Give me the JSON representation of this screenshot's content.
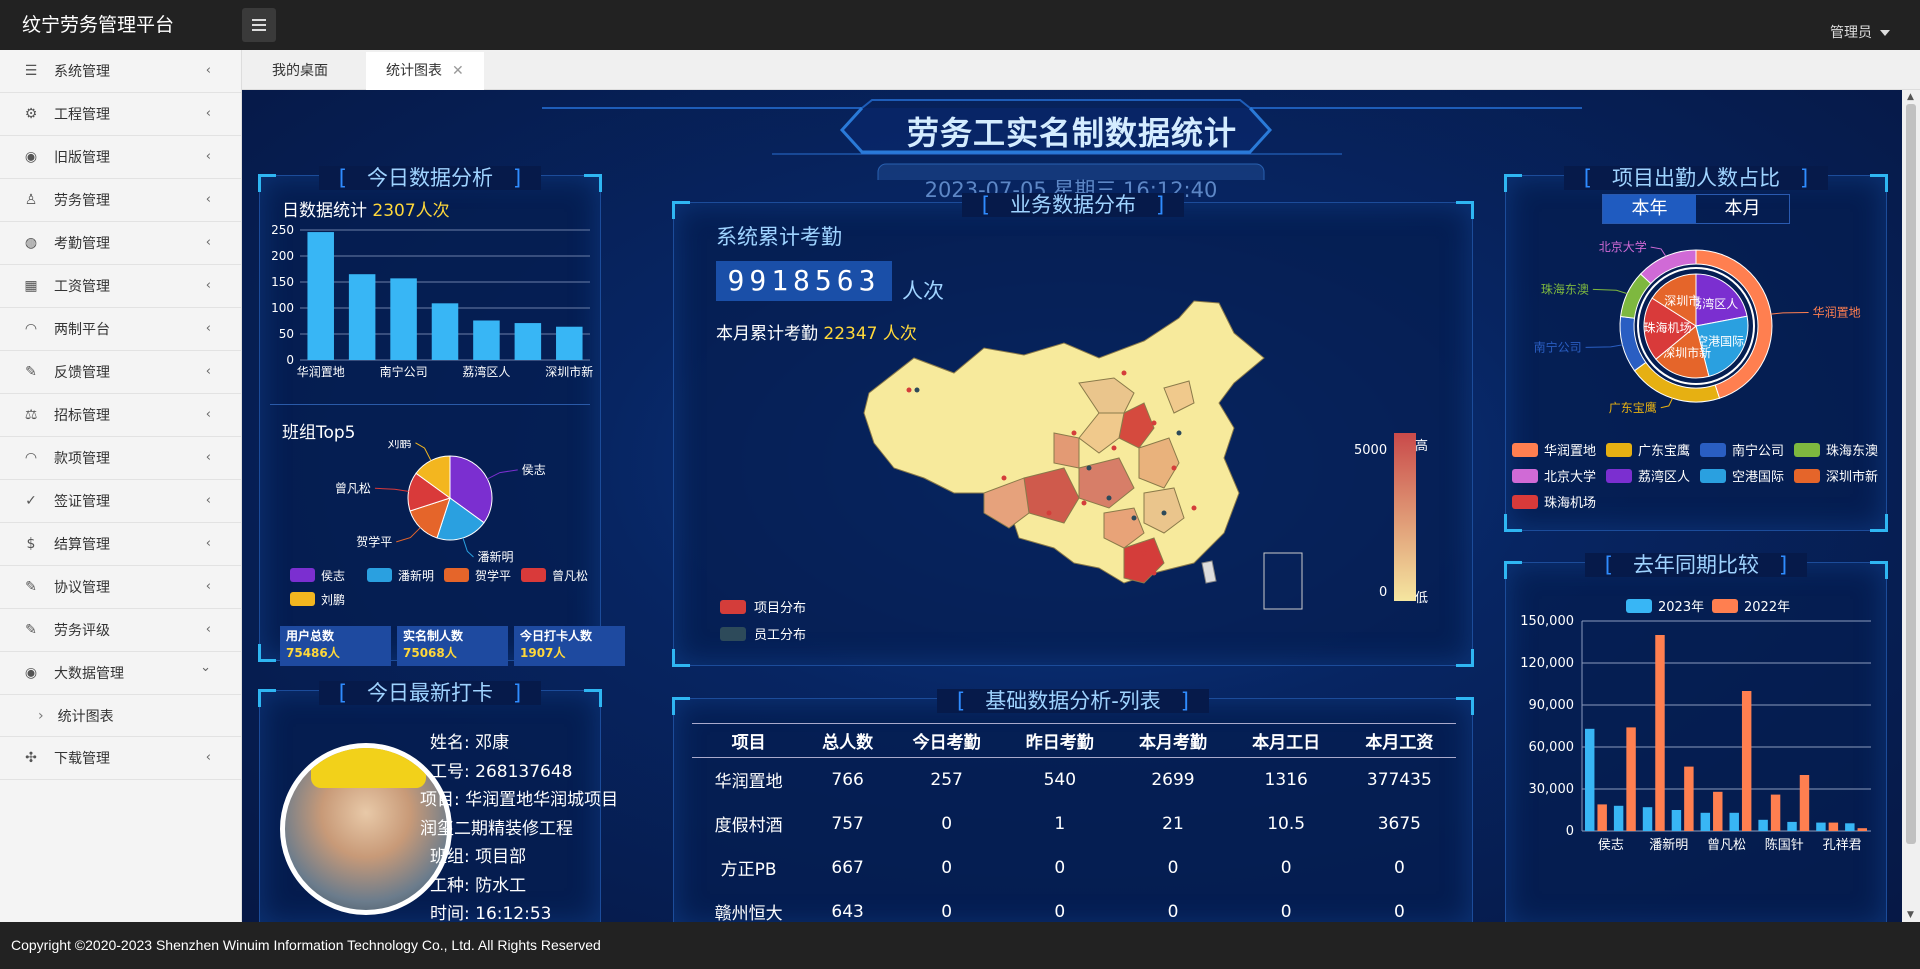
{
  "app": {
    "title": "纹宁劳务管理平台",
    "user": "管理员"
  },
  "sidebar": {
    "items": [
      {
        "label": "系统管理",
        "icon": "database-icon"
      },
      {
        "label": "工程管理",
        "icon": "gear-icon"
      },
      {
        "label": "旧版管理",
        "icon": "eye-icon"
      },
      {
        "label": "劳务管理",
        "icon": "user-icon"
      },
      {
        "label": "考勤管理",
        "icon": "globe-icon"
      },
      {
        "label": "工资管理",
        "icon": "calculator-icon"
      },
      {
        "label": "两制平台",
        "icon": "chart-icon"
      },
      {
        "label": "反馈管理",
        "icon": "edit-icon"
      },
      {
        "label": "招标管理",
        "icon": "scale-icon"
      },
      {
        "label": "款项管理",
        "icon": "chart-icon"
      },
      {
        "label": "签证管理",
        "icon": "check-icon"
      },
      {
        "label": "结算管理",
        "icon": "dollar-icon"
      },
      {
        "label": "协议管理",
        "icon": "edit-icon"
      },
      {
        "label": "劳务评级",
        "icon": "edit-icon"
      },
      {
        "label": "大数据管理",
        "icon": "eye-icon"
      }
    ],
    "sub_item": "统计图表",
    "last_item": {
      "label": "下载管理",
      "icon": "grid-icon"
    }
  },
  "tabs": [
    {
      "label": "我的桌面"
    },
    {
      "label": "统计图表"
    }
  ],
  "dashboard": {
    "title": "劳务工实名制数据统计",
    "datetime": "2023-07-05 星期三 16:12:40",
    "today": {
      "title": "今日数据分析",
      "daily_label": "日数据统计",
      "daily_value": "2307人次",
      "group_title": "班组Top5",
      "stats": [
        {
          "label": "用户总数",
          "value": "75486人"
        },
        {
          "label": "实名制人数",
          "value": "75068人"
        },
        {
          "label": "今日打卡人数",
          "value": "1907人"
        }
      ]
    },
    "business": {
      "title": "业务数据分布",
      "total_label": "系统累计考勤",
      "total_value": "9918563",
      "total_unit": "人次",
      "month_label": "本月累计考勤",
      "month_value": "22347 人次",
      "legend": [
        "项目分布",
        "员工分布"
      ],
      "scale_high": "高",
      "scale_low": "低",
      "scale_max": "5000",
      "scale_min": "0"
    },
    "attendance": {
      "title": "项目出勤人数占比",
      "tab_year": "本年",
      "tab_month": "本月"
    },
    "latest": {
      "title": "今日最新打卡",
      "name": "姓名:  邓康",
      "id": "工号:  268137648",
      "project": "项目:  华润置地华润城项目润玺二期精装修工程",
      "team": "班组:  项目部",
      "trade": "工种:  防水工",
      "time": "时间:  16:12:53"
    },
    "table": {
      "title": "基础数据分析-列表",
      "columns": [
        "项目",
        "总人数",
        "今日考勤",
        "昨日考勤",
        "本月考勤",
        "本月工日",
        "本月工资"
      ],
      "rows": [
        [
          "华润置地",
          "766",
          "257",
          "540",
          "2699",
          "1316",
          "377435"
        ],
        [
          "度假村酒",
          "757",
          "0",
          "1",
          "21",
          "10.5",
          "3675"
        ],
        [
          "方正PB",
          "667",
          "0",
          "0",
          "0",
          "0",
          "0"
        ],
        [
          "赣州恒大",
          "643",
          "0",
          "0",
          "0",
          "0",
          "0"
        ]
      ]
    },
    "compare": {
      "title": "去年同期比较"
    }
  },
  "footer": "Copyright ©2020-2023 Shenzhen Winuim Information Technology Co., Ltd. All Rights Reserved",
  "chart_data": [
    {
      "type": "bar",
      "title": "日数据统计",
      "categories": [
        "华润置地",
        "南宁公司",
        "荔湾区人",
        "深圳市新"
      ],
      "all_categories_note": "",
      "values": [
        246,
        165,
        157,
        109,
        76,
        71,
        64
      ],
      "ylim": [
        0,
        250
      ],
      "yticks": [
        0,
        50,
        100,
        150,
        200,
        250
      ],
      "color": "#38b6f5"
    },
    {
      "type": "pie",
      "title": "班组Top5",
      "labels": [
        "侯志",
        "潘新明",
        "贺学平",
        "曾凡松",
        "刘鹏"
      ],
      "values": [
        35,
        20,
        15,
        15,
        15
      ],
      "colors": [
        "#7b2fd0",
        "#2aa0e0",
        "#e5652a",
        "#d93a3a",
        "#f3b61f"
      ]
    },
    {
      "type": "pie",
      "title": "项目出勤人数占比",
      "labels": [
        "华润置地",
        "广东宝鹰",
        "南宁公司",
        "珠海东澳",
        "北京大学",
        "荔湾区人",
        "空港国际",
        "深圳市新",
        "珠海机场"
      ],
      "outer_values": [
        45,
        20,
        12,
        10,
        13
      ],
      "outer_labels": [
        "华润置地",
        "广东宝鹰",
        "南宁公司",
        "珠海东澳",
        "北京大学"
      ],
      "inner_labels": [
        "荔湾区人",
        "空港国际",
        "深圳市新",
        "珠海机场",
        "深圳市"
      ],
      "inner_values": [
        22,
        24,
        18,
        20,
        16
      ],
      "colors": [
        "#ff7f50",
        "#e6b012",
        "#2a5ec2",
        "#7eb83f",
        "#d06ad6",
        "#7b2fd0",
        "#2aa0e0",
        "#e5652a",
        "#d93a3a"
      ]
    },
    {
      "type": "bar",
      "title": "去年同期比较",
      "categories": [
        "侯志",
        "潘新明",
        "曾凡松",
        "陈国针",
        "孔祥君"
      ],
      "series": [
        {
          "name": "2023年",
          "values": [
            73000,
            18000,
            17000,
            15000,
            13000,
            13000,
            8000,
            6500,
            6000,
            5500
          ],
          "color": "#38b6f5"
        },
        {
          "name": "2022年",
          "values": [
            19000,
            74000,
            140000,
            46000,
            28000,
            100000,
            26000,
            40000,
            6000,
            2000
          ],
          "color": "#ff7f50"
        }
      ],
      "ylim": [
        0,
        150000
      ],
      "yticks": [
        "0",
        "30,000",
        "60,000",
        "90,000",
        "120,000",
        "150,000"
      ]
    }
  ]
}
